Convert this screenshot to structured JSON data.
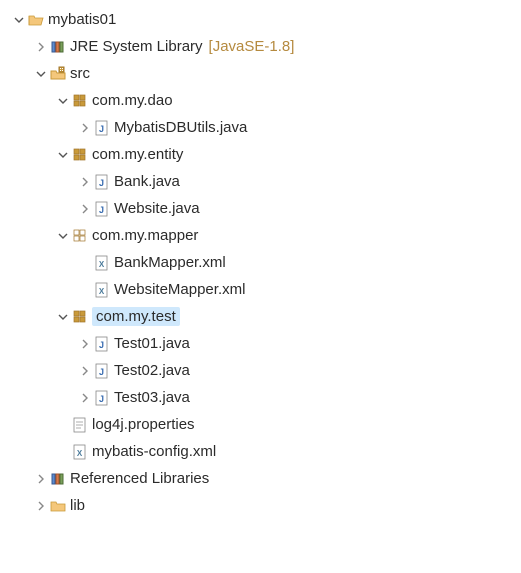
{
  "tree": [
    {
      "depth": 0,
      "arrow": "down",
      "icon": "project-open",
      "label": "mybatis01",
      "decorator": ""
    },
    {
      "depth": 1,
      "arrow": "right",
      "icon": "jre-library",
      "label": "JRE System Library",
      "decorator": "[JavaSE-1.8]"
    },
    {
      "depth": 1,
      "arrow": "down",
      "icon": "folder-src",
      "label": "src",
      "decorator": ""
    },
    {
      "depth": 2,
      "arrow": "down",
      "icon": "package",
      "label": "com.my.dao",
      "decorator": ""
    },
    {
      "depth": 3,
      "arrow": "right",
      "icon": "java-file",
      "label": "MybatisDBUtils.java",
      "decorator": ""
    },
    {
      "depth": 2,
      "arrow": "down",
      "icon": "package",
      "label": "com.my.entity",
      "decorator": ""
    },
    {
      "depth": 3,
      "arrow": "right",
      "icon": "java-file",
      "label": "Bank.java",
      "decorator": ""
    },
    {
      "depth": 3,
      "arrow": "right",
      "icon": "java-file",
      "label": "Website.java",
      "decorator": ""
    },
    {
      "depth": 2,
      "arrow": "down",
      "icon": "package-white",
      "label": "com.my.mapper",
      "decorator": ""
    },
    {
      "depth": 3,
      "arrow": "none",
      "icon": "xml-file",
      "label": "BankMapper.xml",
      "decorator": ""
    },
    {
      "depth": 3,
      "arrow": "none",
      "icon": "xml-file",
      "label": "WebsiteMapper.xml",
      "decorator": ""
    },
    {
      "depth": 2,
      "arrow": "down",
      "icon": "package",
      "label": "com.my.test",
      "decorator": "",
      "selected": true
    },
    {
      "depth": 3,
      "arrow": "right",
      "icon": "java-file",
      "label": "Test01.java",
      "decorator": ""
    },
    {
      "depth": 3,
      "arrow": "right",
      "icon": "java-file",
      "label": "Test02.java",
      "decorator": ""
    },
    {
      "depth": 3,
      "arrow": "right",
      "icon": "java-file",
      "label": "Test03.java",
      "decorator": ""
    },
    {
      "depth": 2,
      "arrow": "none",
      "icon": "text-file",
      "label": "log4j.properties",
      "decorator": ""
    },
    {
      "depth": 2,
      "arrow": "none",
      "icon": "xml-file",
      "label": "mybatis-config.xml",
      "decorator": ""
    },
    {
      "depth": 1,
      "arrow": "right",
      "icon": "ref-library",
      "label": "Referenced Libraries",
      "decorator": ""
    },
    {
      "depth": 1,
      "arrow": "right",
      "icon": "folder",
      "label": "lib",
      "decorator": ""
    }
  ]
}
